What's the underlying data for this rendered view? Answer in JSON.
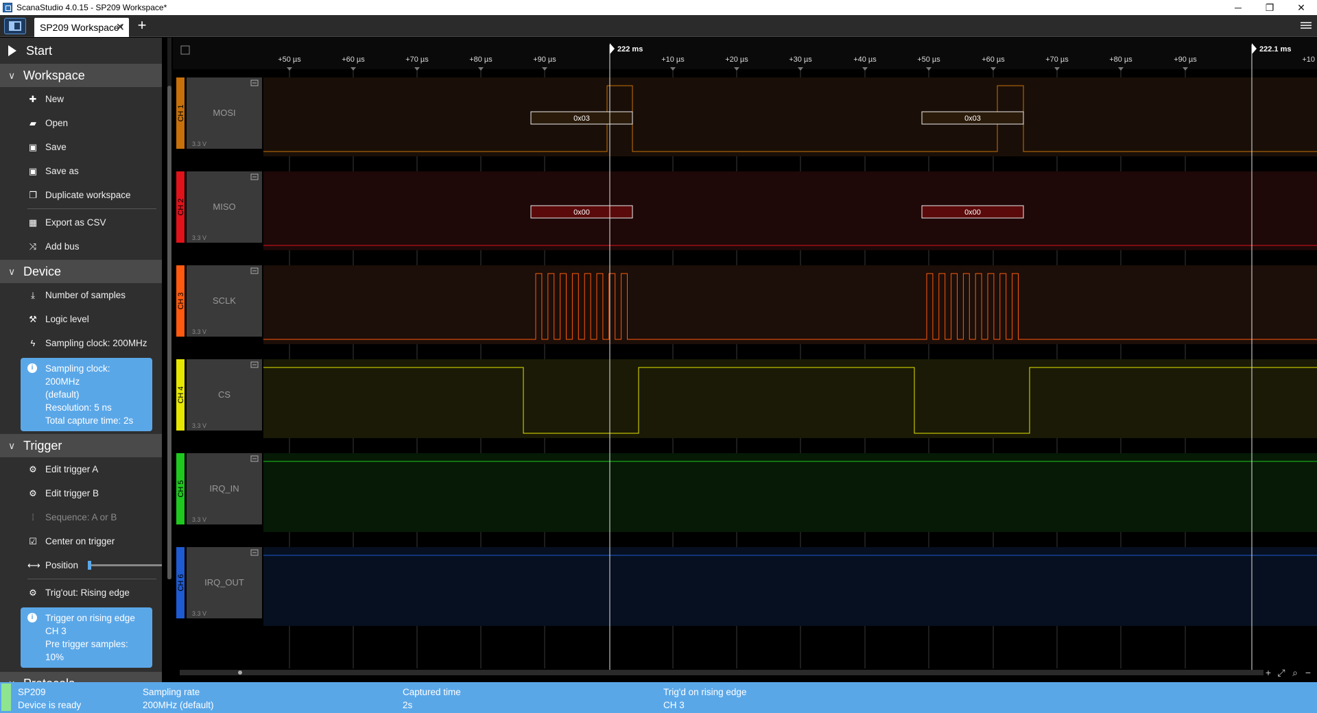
{
  "window": {
    "title": "ScanaStudio 4.0.15 - SP209 Workspace*",
    "minimize": "─",
    "restore": "❐",
    "close": "✕"
  },
  "tabs": {
    "workspace_label": "SP209 Workspace*",
    "close_glyph": "✕",
    "add_glyph": "+"
  },
  "sidebar": {
    "start_label": "Start",
    "workspace": {
      "title": "Workspace",
      "items": [
        "New",
        "Open",
        "Save",
        "Save as",
        "Duplicate workspace",
        "Export as CSV",
        "Add bus"
      ]
    },
    "device": {
      "title": "Device",
      "items": [
        "Number of samples",
        "Logic level",
        "Sampling clock: 200MHz"
      ],
      "info": [
        "Sampling clock: 200MHz",
        "(default)",
        "Resolution: 5 ns",
        "Total capture time: 2s"
      ]
    },
    "trigger": {
      "title": "Trigger",
      "items": [
        "Edit trigger A",
        "Edit trigger B",
        "Sequence: A or B",
        "Center on trigger",
        "Position",
        "Trig'out: Rising edge"
      ],
      "position_fraction": 0.0,
      "info": [
        "Trigger on rising edge",
        "CH 3",
        "Pre trigger samples: 10%"
      ]
    },
    "protocols": {
      "title": "Protocols"
    }
  },
  "timeline": {
    "ticks_left": [
      "+50 µs",
      "+60 µs",
      "+70 µs",
      "+80 µs",
      "+90 µs"
    ],
    "marker1": "222 ms",
    "ticks_mid": [
      "+10 µs",
      "+20 µs",
      "+30 µs",
      "+40 µs",
      "+50 µs",
      "+60 µs",
      "+70 µs",
      "+80 µs",
      "+90 µs"
    ],
    "marker2": "222.1 ms",
    "tick_right": "+10"
  },
  "channels": [
    {
      "ch": "CH 1",
      "name": "MOSI",
      "voltage": "3.3 V",
      "color": "#c8700a",
      "decodes": [
        "0x03",
        "0x03"
      ]
    },
    {
      "ch": "CH 2",
      "name": "MISO",
      "voltage": "3.3 V",
      "color": "#e0121a",
      "decodes": [
        "0x00",
        "0x00"
      ]
    },
    {
      "ch": "CH 3",
      "name": "SCLK",
      "voltage": "3.3 V",
      "color": "#ff5a10",
      "decodes": []
    },
    {
      "ch": "CH 4",
      "name": "CS",
      "voltage": "3.3 V",
      "color": "#e6e600",
      "decodes": []
    },
    {
      "ch": "CH 5",
      "name": "IRQ_IN",
      "voltage": "3.3 V",
      "color": "#1ec81e",
      "decodes": []
    },
    {
      "ch": "CH 6",
      "name": "IRQ_OUT",
      "voltage": "3.3 V",
      "color": "#1e5ad2",
      "decodes": []
    }
  ],
  "colors": {
    "accent": "#5aa7e8",
    "sidebar_bg": "#2f2f2f",
    "section_bg": "#4a4a4a"
  },
  "statusbar": {
    "device_name": "SP209",
    "device_status": "Device is ready",
    "rate_label": "Sampling rate",
    "rate_value": "200MHz (default)",
    "captured_label": "Captured time",
    "captured_value": "2s",
    "trig_label": "Trig'd on rising edge",
    "trig_value": "CH 3"
  }
}
